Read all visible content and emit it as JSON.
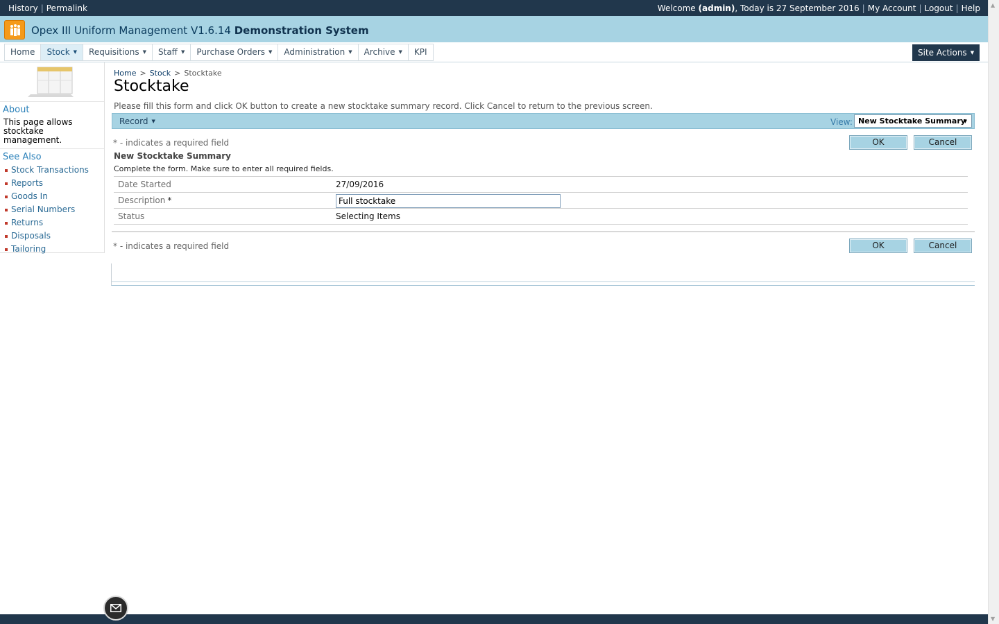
{
  "topbar": {
    "history": "History",
    "permalink": "Permalink",
    "welcome_prefix": "Welcome ",
    "user": "(admin)",
    "today": ", Today is 27 September 2016",
    "my_account": "My Account",
    "logout": "Logout",
    "help": "Help"
  },
  "app": {
    "title": "Opex III Uniform Management V1.6.14",
    "system": "Demonstration System"
  },
  "nav": {
    "items": [
      {
        "label": "Home",
        "dropdown": false
      },
      {
        "label": "Stock",
        "dropdown": true
      },
      {
        "label": "Requisitions",
        "dropdown": true
      },
      {
        "label": "Staff",
        "dropdown": true
      },
      {
        "label": "Purchase Orders",
        "dropdown": true
      },
      {
        "label": "Administration",
        "dropdown": true
      },
      {
        "label": "Archive",
        "dropdown": true
      },
      {
        "label": "KPI",
        "dropdown": false
      }
    ],
    "site_actions": "Site Actions"
  },
  "sidebar": {
    "about_title": "About",
    "about_text": "This page allows stocktake management.",
    "see_also_title": "See Also",
    "links": [
      "Stock Transactions",
      "Reports",
      "Goods In",
      "Serial Numbers",
      "Returns",
      "Disposals",
      "Tailoring"
    ]
  },
  "breadcrumb": {
    "home": "Home",
    "stock": "Stock",
    "current": "Stocktake"
  },
  "page": {
    "title": "Stocktake",
    "instructions": "Please fill this form and click OK button to create a new stocktake summary record. Click Cancel to return to the previous screen."
  },
  "toolbar": {
    "record": "Record",
    "view_label": "View:",
    "view_value": "New Stocktake Summary"
  },
  "form": {
    "required_note": "* - indicates a required field",
    "ok": "OK",
    "cancel": "Cancel",
    "title": "New Stocktake Summary",
    "description": "Complete the form. Make sure to enter all required fields.",
    "fields": {
      "date_started_label": "Date Started",
      "date_started_value": "27/09/2016",
      "description_label": "Description",
      "description_required": "*",
      "description_value": "Full stocktake",
      "status_label": "Status",
      "status_value": "Selecting Items"
    }
  },
  "colors": {
    "dark_bar": "#21374c",
    "accent_blue": "#a7d3e3",
    "link": "#2a80b9",
    "bullet": "#c0392b"
  }
}
